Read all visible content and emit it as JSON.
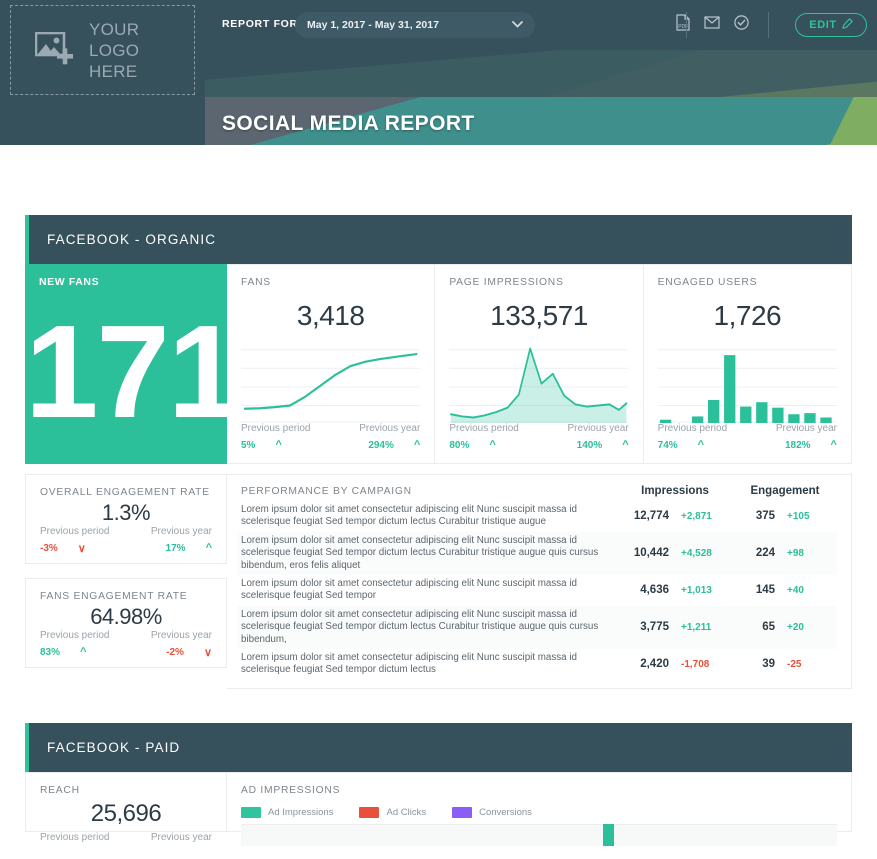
{
  "header": {
    "logo_placeholder_line1": "YOUR LOGO",
    "logo_placeholder_line2": "HERE",
    "report_for_label": "REPORT FOR",
    "date_range": "May 1, 2017 - May 31, 2017",
    "chevron": "⌄",
    "edit_label": "EDIT",
    "icons": [
      "pdf-export-icon",
      "email-icon",
      "schedule-check-icon"
    ],
    "title": "SOCIAL MEDIA REPORT",
    "accent_color": "#2ec499",
    "dark_color": "#36505c",
    "banner_colors": [
      "#5b6670",
      "#3f8f8c",
      "#7fae63"
    ]
  },
  "sections": [
    {
      "title": "FACEBOOK - ORGANIC",
      "hero": {
        "label": "NEW FANS",
        "value": "171"
      },
      "metrics": [
        {
          "label": "FANS",
          "value": "3,418",
          "prev_period_label": "Previous period",
          "prev_period_value": "5%",
          "prev_period_dir": "up",
          "prev_year_label": "Previous year",
          "prev_year_value": "294%",
          "prev_year_dir": "up"
        },
        {
          "label": "PAGE IMPRESSIONS",
          "value": "133,571",
          "prev_period_label": "Previous period",
          "prev_period_value": "80%",
          "prev_period_dir": "up",
          "prev_year_label": "Previous year",
          "prev_year_value": "140%",
          "prev_year_dir": "up"
        },
        {
          "label": "ENGAGED USERS",
          "value": "1,726",
          "prev_period_label": "Previous period",
          "prev_period_value": "74%",
          "prev_period_dir": "up",
          "prev_year_label": "Previous year",
          "prev_year_value": "182%",
          "prev_year_dir": "up"
        }
      ],
      "rates": [
        {
          "label": "OVERALL ENGAGEMENT RATE",
          "value": "1.3%",
          "prev_period_label": "Previous period",
          "prev_period_value": "-3%",
          "prev_period_dir": "down",
          "prev_year_label": "Previous year",
          "prev_year_value": "17%",
          "prev_year_dir": "up"
        },
        {
          "label": "FANS ENGAGEMENT RATE",
          "value": "64.98%",
          "prev_period_label": "Previous period",
          "prev_period_value": "83%",
          "prev_period_dir": "up",
          "prev_year_label": "Previous year",
          "prev_year_value": "-2%",
          "prev_year_dir": "down"
        }
      ],
      "table": {
        "title": "PERFORMANCE BY CAMPAIGN",
        "col_impressions": "Impressions",
        "col_engagement": "Engagement",
        "rows": [
          {
            "desc": "Lorem ipsum dolor sit amet consectetur adipiscing elit Nunc suscipit massa id scelerisque feugiat Sed tempor dictum lectus Curabitur tristique augue",
            "impressions": "12,774",
            "impressions_delta": "+2,871",
            "impressions_dir": "up",
            "engagement": "375",
            "engagement_delta": "+105",
            "engagement_dir": "up"
          },
          {
            "desc": "Lorem ipsum dolor sit amet consectetur adipiscing elit Nunc suscipit massa id scelerisque feugiat Sed tempor dictum lectus Curabitur tristique augue quis cursus bibendum, eros felis aliquet",
            "impressions": "10,442",
            "impressions_delta": "+4,528",
            "impressions_dir": "up",
            "engagement": "224",
            "engagement_delta": "+98",
            "engagement_dir": "up"
          },
          {
            "desc": "Lorem ipsum dolor sit amet consectetur adipiscing elit Nunc suscipit massa id scelerisque feugiat Sed tempor",
            "impressions": "4,636",
            "impressions_delta": "+1,013",
            "impressions_dir": "up",
            "engagement": "145",
            "engagement_delta": "+40",
            "engagement_dir": "up"
          },
          {
            "desc": "Lorem ipsum dolor sit amet consectetur adipiscing elit Nunc suscipit massa id scelerisque feugiat Sed tempor dictum lectus Curabitur tristique augue quis cursus bibendum,",
            "impressions": "3,775",
            "impressions_delta": "+1,211",
            "impressions_dir": "up",
            "engagement": "65",
            "engagement_delta": "+20",
            "engagement_dir": "up"
          },
          {
            "desc": "Lorem ipsum dolor sit amet consectetur adipiscing elit Nunc suscipit massa id scelerisque feugiat Sed tempor dictum lectus",
            "impressions": "2,420",
            "impressions_delta": "-1,708",
            "impressions_dir": "down",
            "engagement": "39",
            "engagement_delta": "-25",
            "engagement_dir": "down"
          }
        ]
      }
    },
    {
      "title": "FACEBOOK - PAID",
      "reach": {
        "label": "REACH",
        "value": "25,696",
        "prev_period_label": "Previous period",
        "prev_year_label": "Previous year"
      },
      "ad_chart": {
        "label": "AD IMPRESSIONS",
        "legend": [
          {
            "name": "Ad Impressions",
            "color": "#2ec4a0"
          },
          {
            "name": "Ad Clicks",
            "color": "#e8503a"
          },
          {
            "name": "Conversions",
            "color": "#8b5cf6"
          }
        ]
      }
    }
  ],
  "chart_data": [
    {
      "type": "line",
      "title": "FANS",
      "name": "fans-sparkline",
      "x": [
        0,
        1,
        2,
        3,
        4,
        5,
        6,
        7,
        8,
        9,
        10,
        11
      ],
      "values": [
        12,
        12,
        13,
        14,
        19,
        27,
        37,
        46,
        53,
        56,
        58,
        61
      ],
      "ylim": [
        0,
        70
      ],
      "grid": true,
      "color": "#2bbf9a"
    },
    {
      "type": "area",
      "title": "PAGE IMPRESSIONS",
      "name": "page-impressions-sparkline",
      "x": [
        0,
        1,
        2,
        3,
        4,
        5,
        6,
        7,
        8,
        9,
        10,
        11,
        12,
        13,
        14,
        15,
        16
      ],
      "values": [
        8,
        6,
        5,
        7,
        10,
        14,
        24,
        68,
        42,
        52,
        30,
        18,
        15,
        16,
        18,
        12,
        17
      ],
      "ylim": [
        0,
        72
      ],
      "grid": true,
      "color": "#2bbf9a"
    },
    {
      "type": "bar",
      "title": "ENGAGED USERS",
      "name": "engaged-users-bars",
      "categories": [
        "1",
        "2",
        "3",
        "4",
        "5",
        "6",
        "7",
        "8",
        "9",
        "10",
        "11"
      ],
      "values": [
        2,
        0,
        5,
        19,
        58,
        13,
        17,
        12,
        7,
        8,
        3
      ],
      "ylim": [
        0,
        70
      ],
      "grid": true,
      "color": "#2bbf9a"
    },
    {
      "type": "bar",
      "title": "AD IMPRESSIONS",
      "name": "ad-impressions-chart",
      "series": [
        {
          "name": "Ad Impressions",
          "color": "#2ec4a0",
          "values": [
            22
          ]
        },
        {
          "name": "Ad Clicks",
          "color": "#e8503a",
          "values": [
            0
          ]
        },
        {
          "name": "Conversions",
          "color": "#8b5cf6",
          "values": [
            0
          ]
        }
      ],
      "categories": [
        "1"
      ]
    }
  ]
}
